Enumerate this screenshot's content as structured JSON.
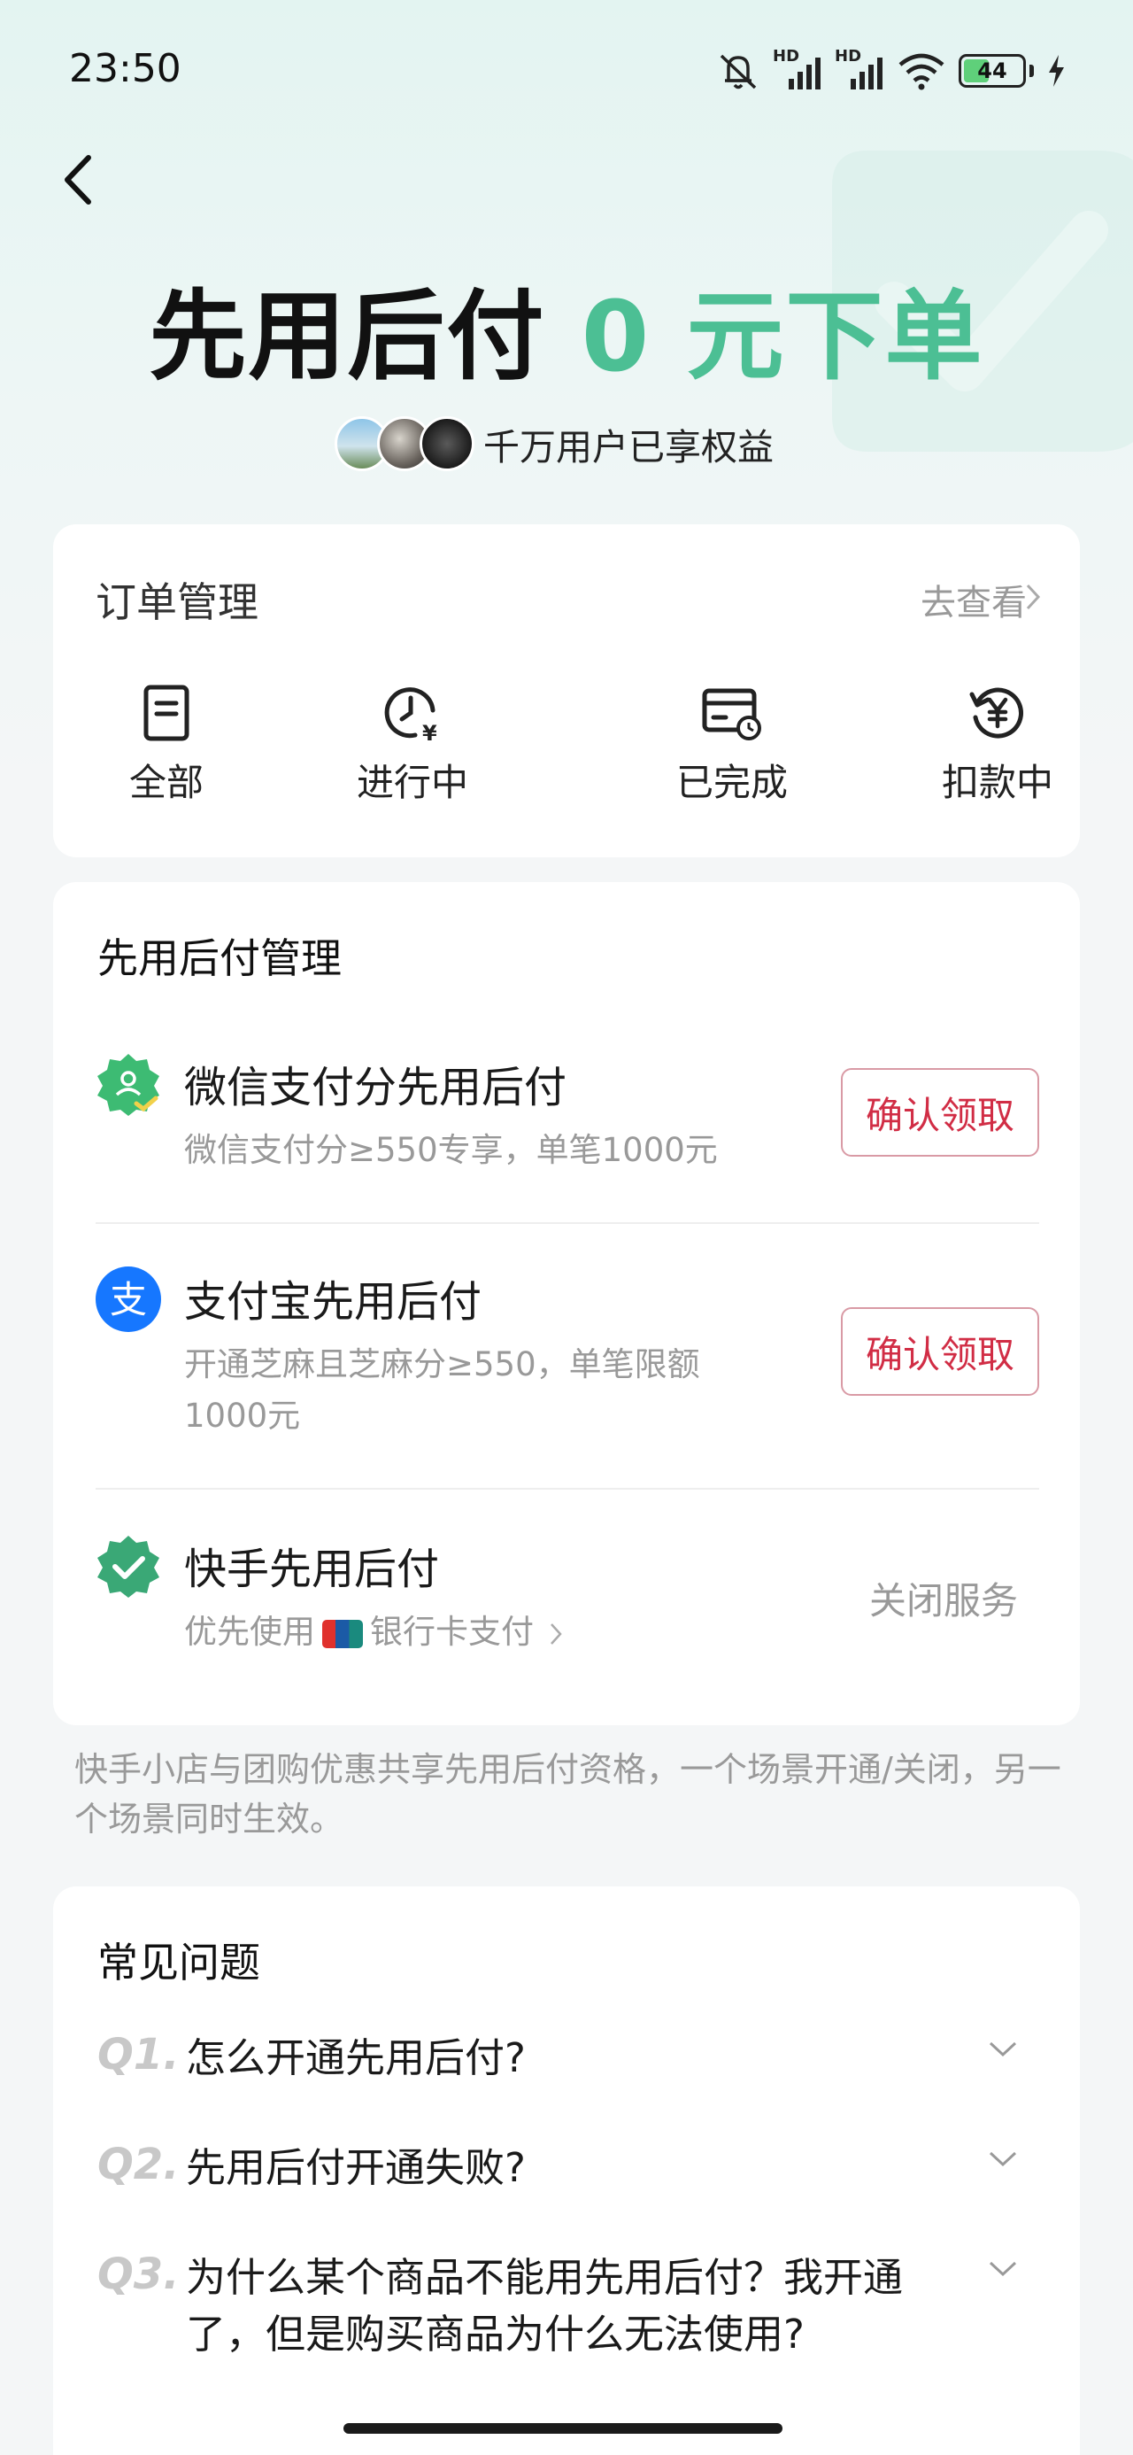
{
  "status": {
    "time": "23:50",
    "battery": "44",
    "network_label_1": "HD",
    "network_label_2": "HD"
  },
  "hero": {
    "title_dark": "先用后付",
    "title_green": "0 元下单",
    "users_text": "千万用户已享权益"
  },
  "order": {
    "title": "订单管理",
    "link": "去查看",
    "items": [
      {
        "label": "全部",
        "icon": "document-icon"
      },
      {
        "label": "进行中",
        "icon": "clock-yen-icon"
      },
      {
        "label": "已完成",
        "icon": "card-clock-icon"
      },
      {
        "label": "扣款中",
        "icon": "refund-yen-icon"
      }
    ]
  },
  "bnpl": {
    "title": "先用后付管理",
    "wechat": {
      "name": "微信支付分先用后付",
      "desc": "微信支付分≥550专享，单笔1000元",
      "button": "确认领取",
      "icon": "wechat-pay-score-icon"
    },
    "alipay": {
      "name": "支付宝先用后付",
      "desc": "开通芝麻且芝麻分≥550，单笔限额1000元",
      "button": "确认领取",
      "icon": "alipay-icon"
    },
    "kuaishou": {
      "name": "快手先用后付",
      "desc_prefix": "优先使用",
      "desc_suffix": "银行卡支付",
      "button": "关闭服务",
      "icon": "verified-check-icon"
    }
  },
  "note": "快手小店与团购优惠共享先用后付资格，一个场景开通/关闭，另一个场景同时生效。",
  "faq": {
    "title": "常见问题",
    "items": [
      {
        "num": "Q1.",
        "question": "怎么开通先用后付?"
      },
      {
        "num": "Q2.",
        "question": "先用后付开通失败?"
      },
      {
        "num": "Q3.",
        "question": "为什么某个商品不能用先用后付？我开通了，但是购买商品为什么无法使用?"
      }
    ]
  },
  "colors": {
    "accent_green": "#4cbf94",
    "claim_red": "#d12d45",
    "alipay_blue": "#1677ff",
    "check_green": "#3aa876"
  }
}
